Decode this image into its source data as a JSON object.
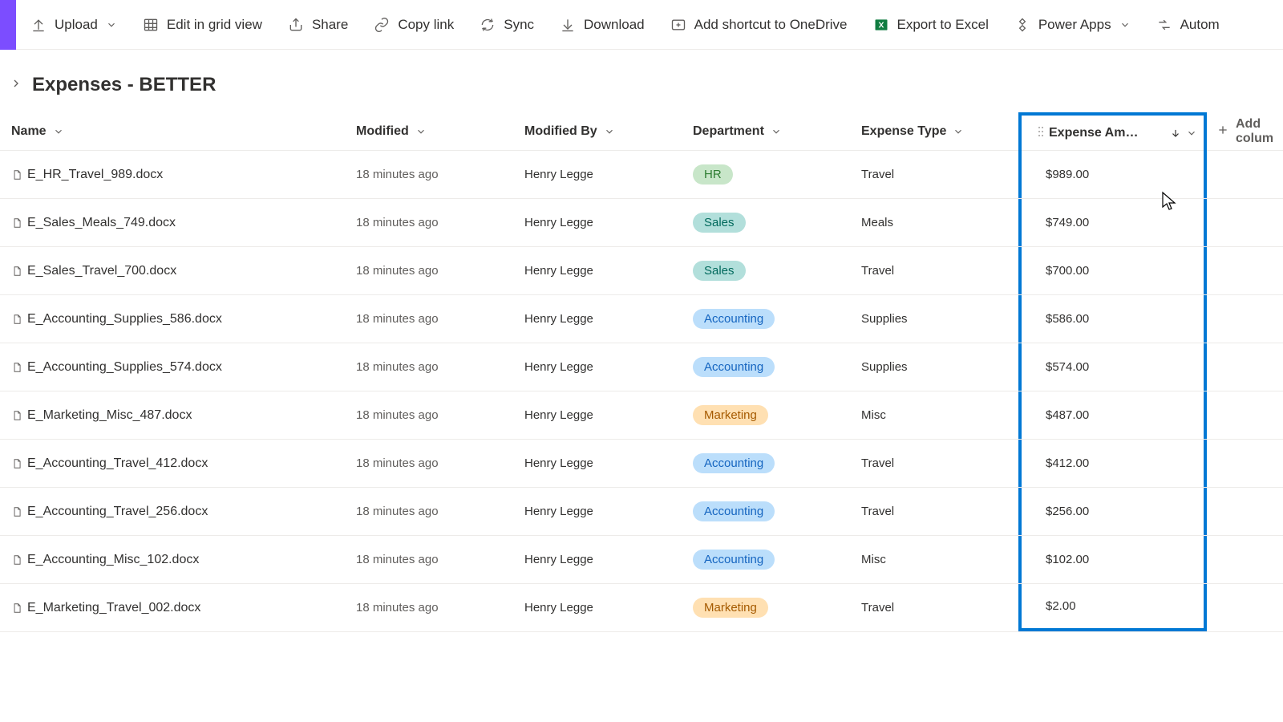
{
  "toolbar": {
    "upload": "Upload",
    "edit_grid": "Edit in grid view",
    "share": "Share",
    "copy_link": "Copy link",
    "sync": "Sync",
    "download": "Download",
    "add_shortcut": "Add shortcut to OneDrive",
    "export_excel": "Export to Excel",
    "power_apps": "Power Apps",
    "automate": "Autom"
  },
  "breadcrumb": {
    "title": "Expenses - BETTER"
  },
  "columns": {
    "name": "Name",
    "modified": "Modified",
    "modified_by": "Modified By",
    "department": "Department",
    "expense_type": "Expense Type",
    "expense_amount": "Expense Am…",
    "add_column": "Add colum"
  },
  "rows": [
    {
      "name": "E_HR_Travel_989.docx",
      "modified": "18 minutes ago",
      "by": "Henry Legge",
      "dept": "HR",
      "type": "Travel",
      "amount": "$989.00"
    },
    {
      "name": "E_Sales_Meals_749.docx",
      "modified": "18 minutes ago",
      "by": "Henry Legge",
      "dept": "Sales",
      "type": "Meals",
      "amount": "$749.00"
    },
    {
      "name": "E_Sales_Travel_700.docx",
      "modified": "18 minutes ago",
      "by": "Henry Legge",
      "dept": "Sales",
      "type": "Travel",
      "amount": "$700.00"
    },
    {
      "name": "E_Accounting_Supplies_586.docx",
      "modified": "18 minutes ago",
      "by": "Henry Legge",
      "dept": "Accounting",
      "type": "Supplies",
      "amount": "$586.00"
    },
    {
      "name": "E_Accounting_Supplies_574.docx",
      "modified": "18 minutes ago",
      "by": "Henry Legge",
      "dept": "Accounting",
      "type": "Supplies",
      "amount": "$574.00"
    },
    {
      "name": "E_Marketing_Misc_487.docx",
      "modified": "18 minutes ago",
      "by": "Henry Legge",
      "dept": "Marketing",
      "type": "Misc",
      "amount": "$487.00"
    },
    {
      "name": "E_Accounting_Travel_412.docx",
      "modified": "18 minutes ago",
      "by": "Henry Legge",
      "dept": "Accounting",
      "type": "Travel",
      "amount": "$412.00"
    },
    {
      "name": "E_Accounting_Travel_256.docx",
      "modified": "18 minutes ago",
      "by": "Henry Legge",
      "dept": "Accounting",
      "type": "Travel",
      "amount": "$256.00"
    },
    {
      "name": "E_Accounting_Misc_102.docx",
      "modified": "18 minutes ago",
      "by": "Henry Legge",
      "dept": "Accounting",
      "type": "Misc",
      "amount": "$102.00"
    },
    {
      "name": "E_Marketing_Travel_002.docx",
      "modified": "18 minutes ago",
      "by": "Henry Legge",
      "dept": "Marketing",
      "type": "Travel",
      "amount": "$2.00"
    }
  ]
}
